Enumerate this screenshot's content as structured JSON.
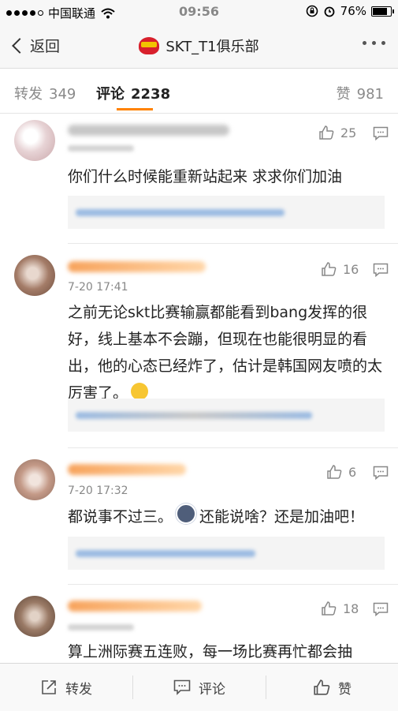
{
  "status_bar": {
    "carrier": "中国联通",
    "time": "09:56",
    "battery": "76%"
  },
  "nav": {
    "back_label": "返回",
    "title": "SKT_T1俱乐部"
  },
  "tabs": [
    {
      "label": "转发",
      "count": "349"
    },
    {
      "label": "评论",
      "count": "2238"
    },
    {
      "label": "赞",
      "count": "981"
    }
  ],
  "comments": [
    {
      "time": "",
      "likes": "25",
      "text": "你们什么时候能重新站起来 求求你们加油",
      "avatar_color": "#e7d3d5"
    },
    {
      "time": "7-20 17:41",
      "likes": "16",
      "text": "之前无论skt比赛输赢都能看到bang发挥的很好，线上基本不会蹦，但现在也能很明显的看出，他的心态已经炸了，估计是韩国网友喷的太厉害了。",
      "avatar_color": "#a47c68"
    },
    {
      "time": "7-20 17:32",
      "likes": "6",
      "text_a": "都说事不过三。",
      "text_b": "还能说啥？还是加油吧！",
      "avatar_color": "#c49a88"
    },
    {
      "time": "",
      "likes": "18",
      "text": "算上洲际赛五连败，每一场比赛再忙都会抽",
      "avatar_color": "#9a7a66"
    }
  ],
  "bottom_bar": {
    "repost_label": "转发",
    "comment_label": "评论",
    "like_label": "赞"
  }
}
